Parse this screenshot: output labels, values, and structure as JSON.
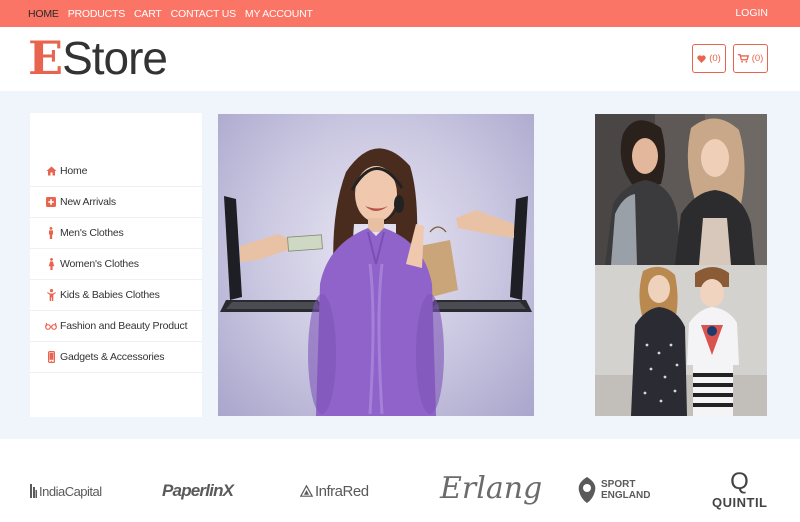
{
  "nav": {
    "items": [
      {
        "label": "HOME",
        "active": true
      },
      {
        "label": "PRODUCTS"
      },
      {
        "label": "CART"
      },
      {
        "label": "CONTACT US"
      },
      {
        "label": "MY ACCOUNT"
      }
    ],
    "login": "LOGIN"
  },
  "header": {
    "logo_initial": "E",
    "logo_rest": "Store",
    "wishlist_count": "(0)",
    "cart_count": "(0)"
  },
  "sidebar": {
    "items": [
      {
        "label": "Home",
        "icon": "home-icon"
      },
      {
        "label": "New Arrivals",
        "icon": "plus-square-icon"
      },
      {
        "label": "Men's Clothes",
        "icon": "male-icon"
      },
      {
        "label": "Women's Clothes",
        "icon": "female-icon"
      },
      {
        "label": "Kids & Babies Clothes",
        "icon": "child-icon"
      },
      {
        "label": "Fashion and Beauty Product",
        "icon": "glasses-icon"
      },
      {
        "label": "Gadgets & Accessories",
        "icon": "mobile-icon"
      }
    ]
  },
  "brands": {
    "items": [
      "IndiaCapital",
      "PaperlinX",
      "InfraRed",
      "Erlang",
      "SPORT",
      "ENGLAND",
      "Q",
      "QUINTIL"
    ]
  },
  "colors": {
    "accent": "#fa7565",
    "logo_e": "#e8644f",
    "band_bg": "#f0f4fb"
  }
}
